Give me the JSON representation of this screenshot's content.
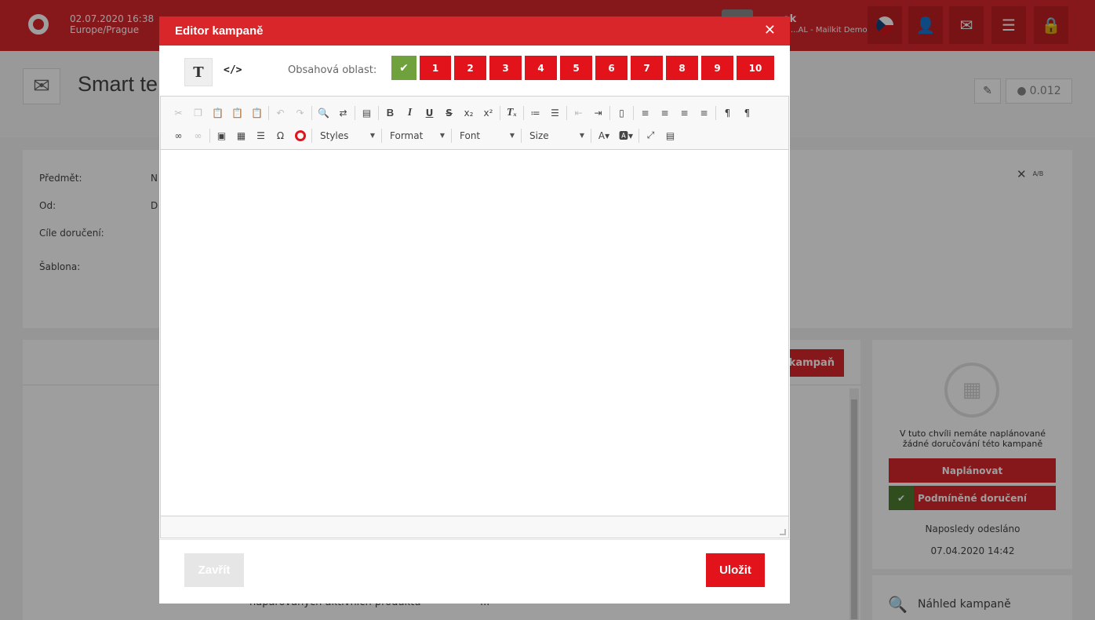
{
  "topbar": {
    "date": "02.07.2020 16:38",
    "timezone": "Europe/Prague",
    "user_name": "...ek",
    "company": "...AL - Mailkit Demo",
    "icons": [
      "flag-cz-icon",
      "user-icon",
      "inbox-icon",
      "stack-icon",
      "lock-icon"
    ]
  },
  "page": {
    "title": "Smart te",
    "price": "0.012"
  },
  "form": {
    "subject_label": "Předmět:",
    "subject_value": "N",
    "from_label": "Od:",
    "from_value": "D",
    "targets_label": "Cíle doručení:",
    "template_label": "Šablona:",
    "ab_label": "A/B"
  },
  "content": {
    "bg_button": "kampaň",
    "bottom_left": "naparovaných aktivních produktů",
    "bottom_right": "..."
  },
  "side": {
    "message": "V tuto chvíli nemáte naplánované žádné doručování této kampaně",
    "schedule_button": "Naplánovat",
    "conditional_button": "Podmíněné doručení",
    "last_sent_label": "Naposledy odesláno",
    "last_sent_value": "07.04.2020 14:42",
    "preview_label": "Náhled kampaně"
  },
  "modal": {
    "title": "Editor kampaně",
    "close_glyph": "✕",
    "mode_visual_glyph": "T",
    "mode_code_glyph": "</>",
    "area_label": "Obsahová oblast:",
    "area_tabs": [
      "1",
      "2",
      "3",
      "4",
      "5",
      "6",
      "7",
      "8",
      "9",
      "10"
    ],
    "toolbar": {
      "styles": "Styles",
      "format": "Format",
      "font": "Font",
      "size": "Size"
    },
    "close_button": "Zavřít",
    "save_button": "Uložit"
  }
}
